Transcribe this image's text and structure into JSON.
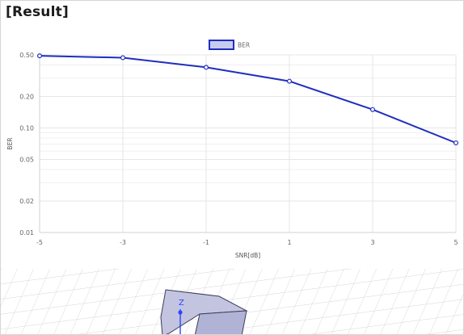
{
  "header": {
    "title": "[Result]"
  },
  "colors": {
    "series": "#1f2ebf",
    "series_fill": "#c7ccef",
    "grid": "#e6e6e6",
    "axis_text": "#666666"
  },
  "chart_data": {
    "type": "line",
    "title": "",
    "xlabel": "SNR[dB]",
    "ylabel": "BER",
    "yscale": "log",
    "ylim": [
      0.01,
      0.5
    ],
    "grid": true,
    "legend_position": "top-center",
    "x_tick_labels": [
      "-5",
      "-3",
      "-1",
      "1",
      "3",
      "5"
    ],
    "y_tick_labels": [
      "0.50",
      "0.20",
      "0.10",
      "0.05",
      "0.02",
      "0.01"
    ],
    "y_tick_values": [
      0.5,
      0.2,
      0.1,
      0.05,
      0.02,
      0.01
    ],
    "series": [
      {
        "name": "BER",
        "color": "#1f2ebf",
        "x": [
          -5,
          -3,
          -1,
          1,
          3,
          5
        ],
        "values": [
          0.49,
          0.47,
          0.38,
          0.28,
          0.15,
          0.072
        ]
      }
    ]
  },
  "viewer": {
    "axis_label": "Z"
  }
}
